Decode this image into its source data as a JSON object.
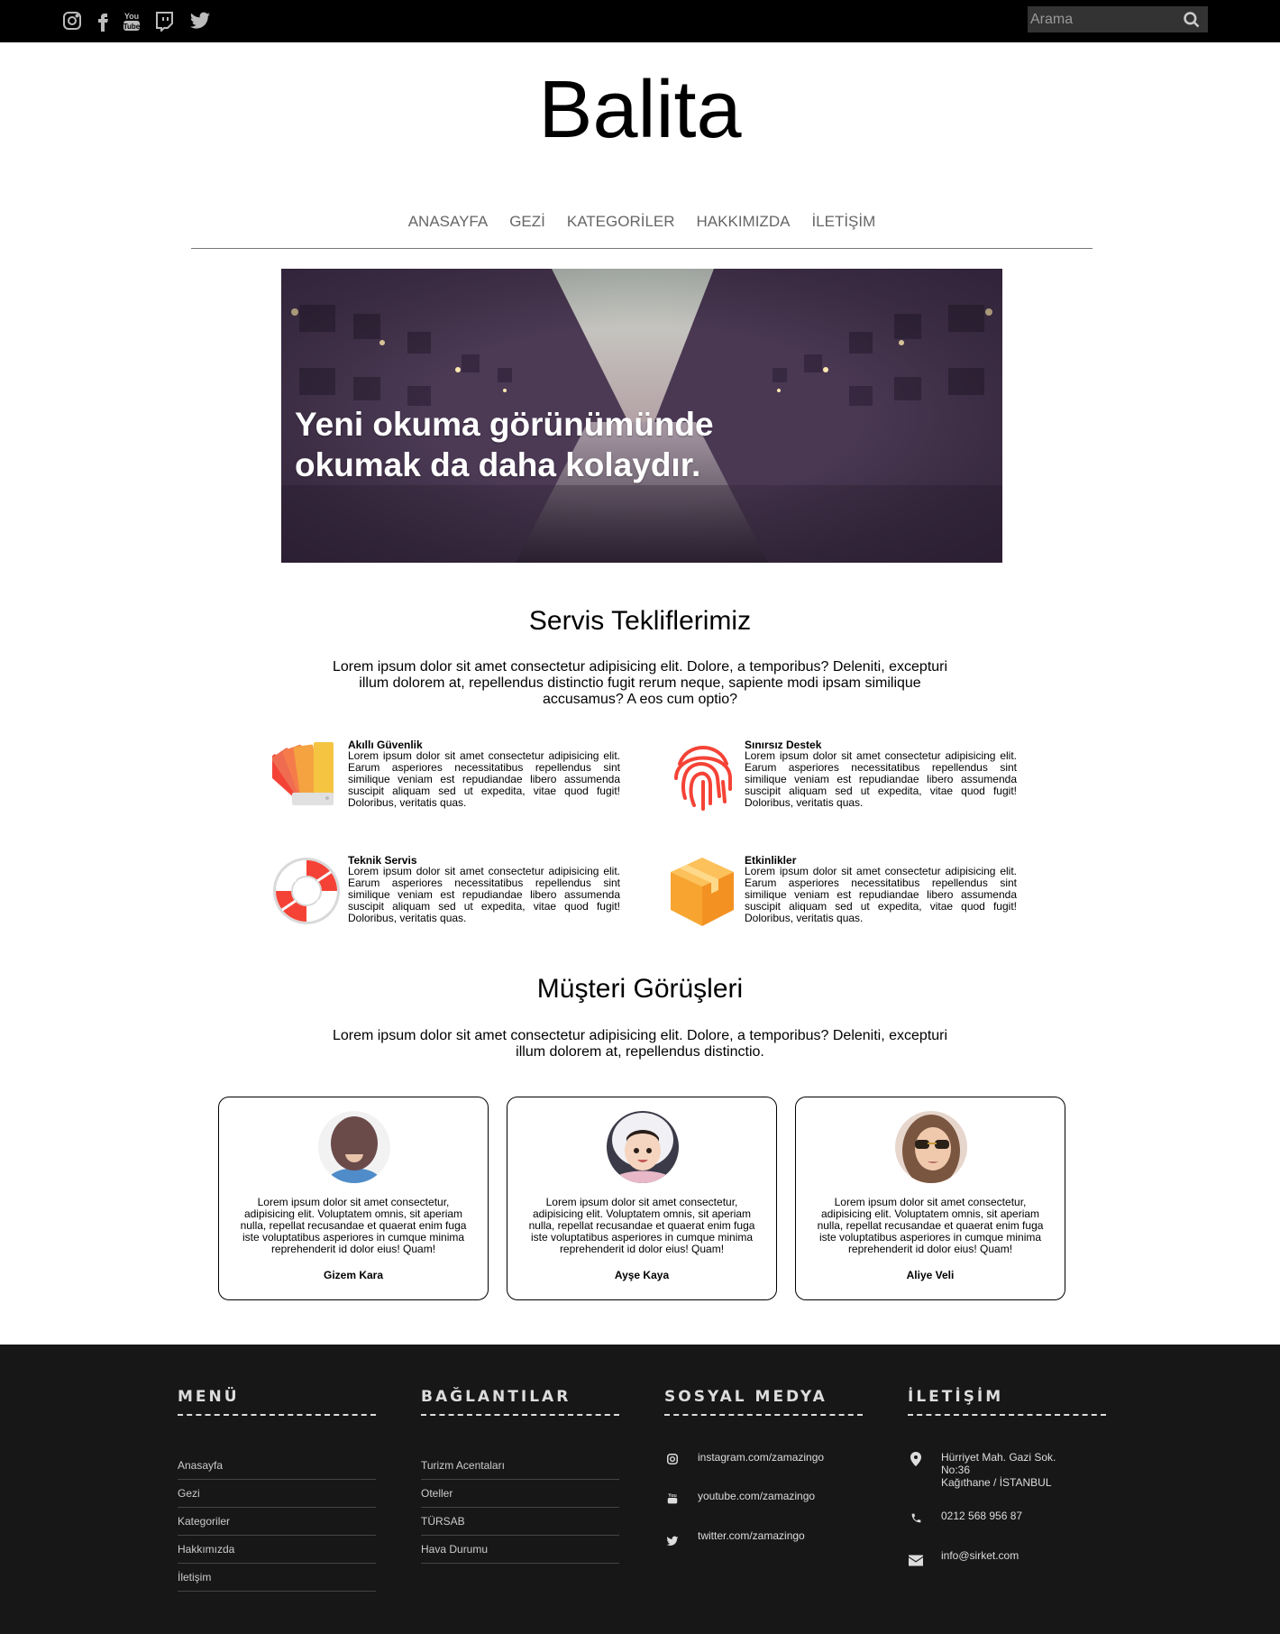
{
  "topbar": {
    "socials": [
      "instagram-icon",
      "facebook-icon",
      "youtube-icon",
      "twitch-icon",
      "twitter-icon"
    ],
    "search_placeholder": "Arama"
  },
  "logo": "Balita",
  "nav": [
    "ANASAYFA",
    "GEZİ",
    "KATEGORİLER",
    "HAKKIMIZDA",
    "İLETİŞİM"
  ],
  "hero": {
    "line1": "Yeni okuma görünümünde",
    "line2": "okumak da daha kolaydır."
  },
  "services": {
    "title": "Servis Tekliflerimiz",
    "description": "Lorem ipsum dolor sit amet consectetur adipisicing elit. Dolore, a temporibus? Deleniti, excepturi illum dolorem at, repellendus distinctio fugit rerum neque, sapiente modi ipsam similique accusamus? A eos cum optio?",
    "items": [
      {
        "title": "Akıllı Güvenlik",
        "icon": "color-swatch-icon",
        "text": "Lorem ipsum dolor sit amet consectetur adipisicing elit. Earum asperiores necessitatibus repellendus sint similique veniam est repudiandae libero assumenda suscipit aliquam sed ut expedita, vitae quod fugit! Doloribus, veritatis quas."
      },
      {
        "title": "Sınırsız Destek",
        "icon": "fingerprint-icon",
        "text": "Lorem ipsum dolor sit amet consectetur adipisicing elit. Earum asperiores necessitatibus repellendus sint similique veniam est repudiandae libero assumenda suscipit aliquam sed ut expedita, vitae quod fugit! Doloribus, veritatis quas."
      },
      {
        "title": "Teknik Servis",
        "icon": "lifebuoy-icon",
        "text": "Lorem ipsum dolor sit amet consectetur adipisicing elit. Earum asperiores necessitatibus repellendus sint similique veniam est repudiandae libero assumenda suscipit aliquam sed ut expedita, vitae quod fugit! Doloribus, veritatis quas."
      },
      {
        "title": "Etkinlikler",
        "icon": "box-icon",
        "text": "Lorem ipsum dolor sit amet consectetur adipisicing elit. Earum asperiores necessitatibus repellendus sint similique veniam est repudiandae libero assumenda suscipit aliquam sed ut expedita, vitae quod fugit! Doloribus, veritatis quas."
      }
    ]
  },
  "testimonials": {
    "title": "Müşteri Görüşleri",
    "description": "Lorem ipsum dolor sit amet consectetur adipisicing elit. Dolore, a temporibus? Deleniti, excepturi illum dolorem at, repellendus distinctio.",
    "items": [
      {
        "text": "Lorem ipsum dolor sit amet consectetur, adipisicing elit. Voluptatem omnis, sit aperiam nulla, repellat recusandae et quaerat enim fuga iste voluptatibus asperiores in cumque minima reprehenderit id dolor eius! Quam!",
        "name": "Gizem Kara"
      },
      {
        "text": "Lorem ipsum dolor sit amet consectetur, adipisicing elit. Voluptatem omnis, sit aperiam nulla, repellat recusandae et quaerat enim fuga iste voluptatibus asperiores in cumque minima reprehenderit id dolor eius! Quam!",
        "name": "Ayşe Kaya"
      },
      {
        "text": "Lorem ipsum dolor sit amet consectetur, adipisicing elit. Voluptatem omnis, sit aperiam nulla, repellat recusandae et quaerat enim fuga iste voluptatibus asperiores in cumque minima reprehenderit id dolor eius! Quam!",
        "name": "Aliye Veli"
      }
    ]
  },
  "footer": {
    "menu": {
      "title": "MENÜ",
      "links": [
        "Anasayfa",
        "Gezi",
        "Kategoriler",
        "Hakkımızda",
        "İletişim"
      ]
    },
    "links": {
      "title": "BAĞLANTILAR",
      "links": [
        "Turizm Acentaları",
        "Oteller",
        "TÜRSAB",
        "Hava Durumu"
      ]
    },
    "social": {
      "title": "SOSYAL MEDYA",
      "items": [
        {
          "icon": "instagram-icon",
          "text": "instagram.com/zamazingo"
        },
        {
          "icon": "youtube-icon",
          "text": "youtube.com/zamazingo"
        },
        {
          "icon": "twitter-icon",
          "text": "twitter.com/zamazingo"
        }
      ]
    },
    "contact": {
      "title": "İLETİŞİM",
      "address_line1": "Hürriyet Mah. Gazi Sok.",
      "address_line2": "No:36",
      "address_line3": "Kağıthane / İSTANBUL",
      "phone": "0212 568 956 87",
      "email": "info@sirket.com"
    }
  },
  "colors": {
    "topbar": "#000000",
    "footer": "#171717",
    "accent_orange": "#f5a623",
    "accent_red": "#f44336"
  }
}
